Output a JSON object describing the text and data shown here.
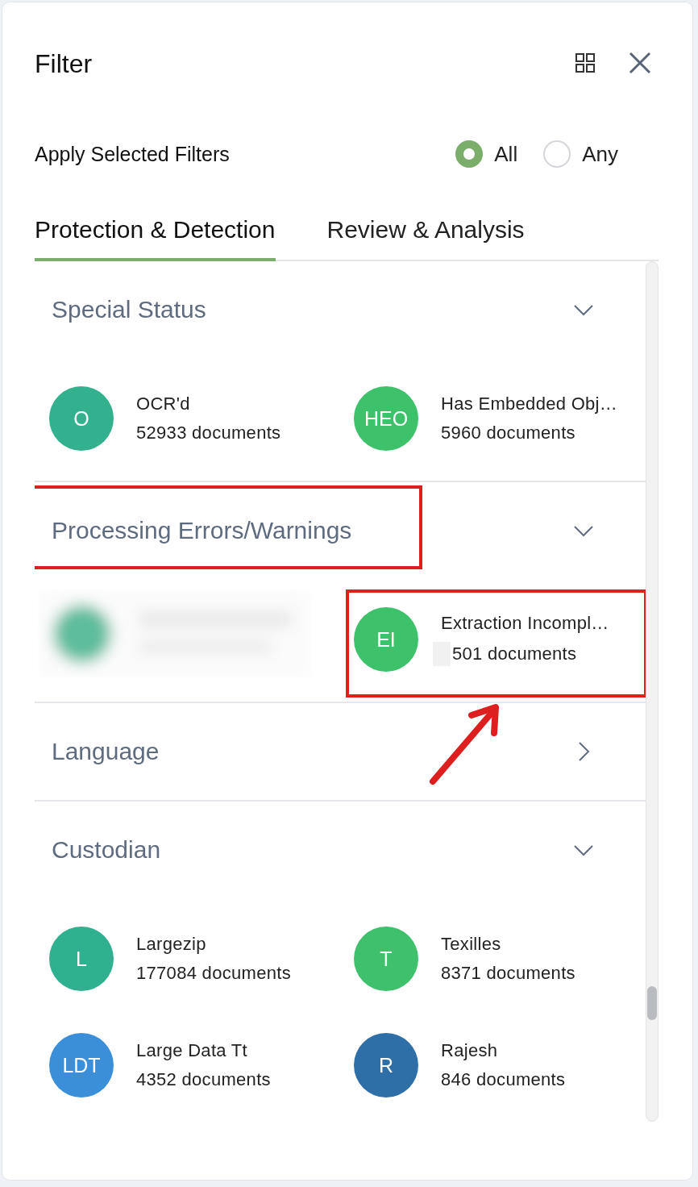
{
  "title": "Filter",
  "apply": {
    "label": "Apply Selected Filters",
    "options": [
      {
        "label": "All",
        "selected": true
      },
      {
        "label": "Any",
        "selected": false
      }
    ]
  },
  "tabs": [
    {
      "label": "Protection & Detection",
      "selected": true
    },
    {
      "label": "Review & Analysis",
      "selected": false
    }
  ],
  "sections": [
    {
      "title": "Special Status",
      "expanded": true,
      "highlighted": false,
      "items": [
        {
          "kind": "entry",
          "initials": "O",
          "color": "#33b18f",
          "name": "OCR'd",
          "count": "52933 documents",
          "highlighted": false
        },
        {
          "kind": "entry",
          "initials": "HEO",
          "color": "#3dc16a",
          "name": "Has Embedded Obj…",
          "count": "5960 documents",
          "highlighted": false
        }
      ]
    },
    {
      "title": "Processing Errors/Warnings",
      "expanded": true,
      "highlighted": true,
      "items": [
        {
          "kind": "redacted"
        },
        {
          "kind": "entry",
          "initials": "EI",
          "color": "#3dc16a",
          "name": "Extraction Incompl…",
          "count": "501 documents",
          "redacted_mark": true,
          "highlighted": true
        }
      ]
    },
    {
      "title": "Language",
      "expanded": false,
      "highlighted": false
    },
    {
      "title": "Custodian",
      "expanded": true,
      "highlighted": false,
      "items": [
        {
          "kind": "entry",
          "initials": "L",
          "color": "#2fb08f",
          "name": "Largezip",
          "count": "177084 documents",
          "highlighted": false
        },
        {
          "kind": "entry",
          "initials": "T",
          "color": "#3ec06c",
          "name": "Texilles",
          "count": "8371 documents",
          "highlighted": false
        },
        {
          "kind": "entry",
          "initials": "LDT",
          "color": "#3b8fd9",
          "name": "Large Data Tt",
          "count": "4352 documents",
          "highlighted": false
        },
        {
          "kind": "entry",
          "initials": "R",
          "color": "#2f6fa8",
          "name": "Rajesh",
          "count": "846 documents",
          "highlighted": false
        }
      ]
    }
  ]
}
